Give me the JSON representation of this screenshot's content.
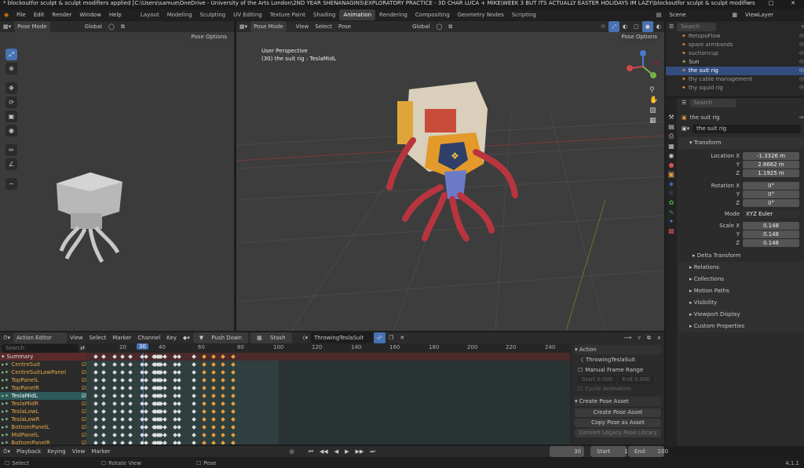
{
  "window": {
    "title": "* blockoutfor sculpt & sculpt modifiers applied [C:\\Users\\samue\\OneDrive - University of the Arts London\\2ND YEAR SHENANAGINS\\EXPLORATORY PRACTICE - 3D CHAR LUCA + MIKE\\WEEK 3 BUT ITS ACTUALLY EASTER HOLIDAYS IM LAZY\\blockoutfor sculpt & sculpt modifiers",
    "controls": [
      "–",
      "□",
      "✕"
    ]
  },
  "menu": {
    "items": [
      "File",
      "Edit",
      "Render",
      "Window",
      "Help"
    ],
    "workspaces": [
      "Layout",
      "Modeling",
      "Sculpting",
      "UV Editing",
      "Texture Paint",
      "Shading",
      "Animation",
      "Rendering",
      "Compositing",
      "Geometry Nodes",
      "Scripting"
    ],
    "active_workspace": "Animation",
    "scene": "Scene",
    "view_layer": "ViewLayer"
  },
  "left_viewport": {
    "mode": "Pose Mode",
    "orientation": "Global",
    "pose_options": "Pose Options"
  },
  "main_viewport": {
    "mode": "Pose Mode",
    "menu": [
      "View",
      "Select",
      "Pose"
    ],
    "orientation": "Global",
    "pose_options": "Pose Options",
    "overlay_line1": "User Perspective",
    "overlay_line2": "(30) the suit rig : TeslaMidL"
  },
  "outliner": {
    "search_placeholder": "Search",
    "items": [
      {
        "name": "RetopoFlow",
        "selected": false
      },
      {
        "name": "spare armbands",
        "selected": false
      },
      {
        "name": "suctioncup",
        "selected": false
      },
      {
        "name": "Sun",
        "selected": false
      },
      {
        "name": "the suit rig",
        "selected": true
      },
      {
        "name": "thy cable management",
        "selected": false
      },
      {
        "name": "thy squid rig",
        "selected": false
      }
    ]
  },
  "properties": {
    "search_placeholder": "Search",
    "object_name": "the suit rig",
    "object_field": "the suit rig",
    "transform_label": "Transform",
    "location": {
      "label_x": "Location X",
      "label_y": "Y",
      "label_z": "Z",
      "x": "-1.3326 m",
      "y": "2.8662 m",
      "z": "1.1925 m"
    },
    "rotation": {
      "label_x": "Rotation X",
      "label_y": "Y",
      "label_z": "Z",
      "x": "0°",
      "y": "0°",
      "z": "0°"
    },
    "mode_label": "Mode",
    "mode_value": "XYZ Euler",
    "scale": {
      "label_x": "Scale X",
      "label_y": "Y",
      "label_z": "Z",
      "x": "0.148",
      "y": "0.148",
      "z": "0.148"
    },
    "panels": [
      "Delta Transform",
      "Relations",
      "Collections",
      "Motion Paths",
      "Visibility",
      "Viewport Display",
      "Custom Properties"
    ]
  },
  "action_editor": {
    "editor_type": "Action Editor",
    "menu": [
      "View",
      "Select",
      "Marker",
      "Channel",
      "Key"
    ],
    "push_down": "Push Down",
    "stash": "Stash",
    "action_name": "ThrowingTeslaSuit",
    "search_placeholder": "Search",
    "frame_labels": [
      "20",
      "30",
      "40",
      "60",
      "80",
      "100",
      "120",
      "140",
      "160",
      "180",
      "200",
      "220",
      "240"
    ],
    "current_frame_label": "30",
    "channels": [
      {
        "name": "Summary",
        "summary": true
      },
      {
        "name": "CentreSuit",
        "selected": false
      },
      {
        "name": "CentreSuitLowPanel",
        "selected": false
      },
      {
        "name": "TopPanelL",
        "selected": false
      },
      {
        "name": "TopPanelR",
        "selected": false
      },
      {
        "name": "TeslaMidL",
        "selected": true
      },
      {
        "name": "TeslaMidR",
        "selected": false
      },
      {
        "name": "TeslaLowL",
        "selected": false
      },
      {
        "name": "TeslaLowR",
        "selected": false
      },
      {
        "name": "BottomPanelL",
        "selected": false
      },
      {
        "name": "MidPanelL",
        "selected": false
      },
      {
        "name": "BottomPanelR",
        "selected": false
      }
    ],
    "keyframes": [
      4,
      8,
      14,
      18,
      22,
      28,
      30,
      34,
      35,
      36,
      37,
      38,
      40,
      45,
      47,
      55,
      60,
      65,
      70,
      75
    ],
    "orange_keyframes": [
      60,
      65,
      70,
      75
    ]
  },
  "action_sidebar": {
    "action_header": "Action",
    "action_name": "ThrowingTeslaSuit",
    "manual_frame_range": "Manual Frame Range",
    "start_label": "Start",
    "start_value": "0.000",
    "end_label": "End",
    "end_value": "0.000",
    "cyclic": "Cyclic Animation",
    "create_pose_header": "Create Pose Asset",
    "create_pose_asset": "Create Pose Asset",
    "copy_pose_asset": "Copy Pose as Asset",
    "convert_legacy": "Convert Legacy Pose Library"
  },
  "timeline": {
    "menu": [
      "Playback",
      "Keying",
      "View",
      "Marker"
    ],
    "current_frame": "30",
    "start_label": "Start",
    "start_value": "1",
    "end_label": "End",
    "end_value": "100"
  },
  "statusbar": {
    "select": "Select",
    "rotate_view": "Rotate View",
    "pose": "Pose",
    "version": "4.1.1"
  }
}
